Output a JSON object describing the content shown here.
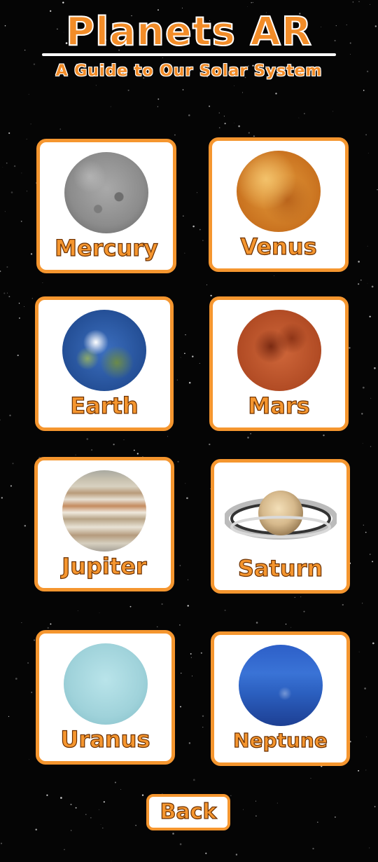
{
  "header": {
    "title": "Planets AR",
    "subtitle": "A Guide to Our Solar System"
  },
  "planets": [
    {
      "name": "Mercury",
      "image": "mercury-image"
    },
    {
      "name": "Venus",
      "image": "venus-image"
    },
    {
      "name": "Earth",
      "image": "earth-image"
    },
    {
      "name": "Mars",
      "image": "mars-image"
    },
    {
      "name": "Jupiter",
      "image": "jupiter-image"
    },
    {
      "name": "Saturn",
      "image": "saturn-image"
    },
    {
      "name": "Uranus",
      "image": "uranus-image"
    },
    {
      "name": "Neptune",
      "image": "neptune-image"
    }
  ],
  "back_button": {
    "label": "Back"
  },
  "colors": {
    "accent": "#f5962f",
    "background": "#050505",
    "card": "#ffffff"
  }
}
